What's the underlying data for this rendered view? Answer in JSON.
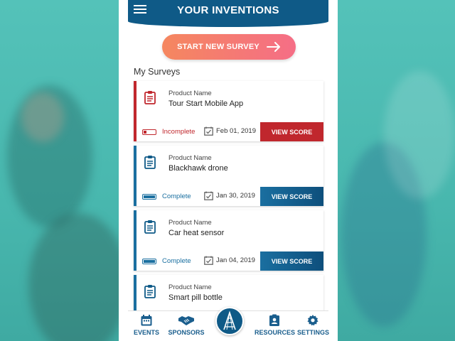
{
  "header": {
    "title": "YOUR INVENTIONS",
    "menu_icon": "hamburger-icon"
  },
  "start_button": {
    "label": "START NEW SURVEY",
    "icon": "arrow-right-icon"
  },
  "section_title": "My Surveys",
  "surveys": [
    {
      "label": "Product Name",
      "name": "Tour Start Mobile App",
      "status": "Incomplete",
      "date": "Feb 01, 2019",
      "action": "VIEW SCORE",
      "accent": "#c0272d"
    },
    {
      "label": "Product Name",
      "name": "Blackhawk drone",
      "status": "Complete",
      "date": "Jan 30, 2019",
      "action": "VIEW SCORE",
      "accent": "#1a6fa0"
    },
    {
      "label": "Product Name",
      "name": "Car heat sensor",
      "status": "Complete",
      "date": "Jan 04, 2019",
      "action": "VIEW SCORE",
      "accent": "#1a6fa0"
    },
    {
      "label": "Product Name",
      "name": "Smart pill bottle"
    }
  ],
  "nav": {
    "events": "EVENTS",
    "sponsors": "SPONSORS",
    "resources": "RESOURCES",
    "settings": "SETTINGS"
  },
  "colors": {
    "header": "#0f5a87",
    "accent_start": "#f5875f",
    "accent_end": "#f56e86",
    "incomplete": "#c0272d",
    "complete": "#1a6fa0"
  }
}
